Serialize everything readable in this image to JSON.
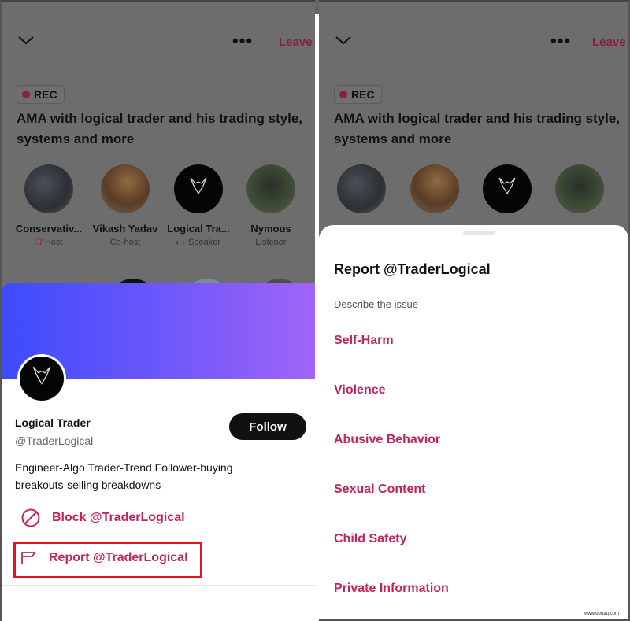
{
  "space": {
    "leave_label": "Leave",
    "more_label": "•••",
    "rec_label": "REC",
    "title": "AMA with logical trader and his trading style, systems and more",
    "speakers": [
      {
        "name": "Conservativ...",
        "role": "Host",
        "status_icon": "mic-off-icon"
      },
      {
        "name": "Vikash Yadav",
        "role": "Co-host",
        "status_icon": ""
      },
      {
        "name": "Logical Tra...",
        "role": "Speaker",
        "status_icon": "speaking-bars-icon"
      },
      {
        "name": "Nymous",
        "role": "Listener",
        "status_icon": ""
      }
    ]
  },
  "profile": {
    "name": "Logical Trader",
    "handle": "@TraderLogical",
    "follow_label": "Follow",
    "bio": "Engineer-Algo Trader-Trend Follower-buying breakouts-selling breakdowns",
    "block_label": "Block @TraderLogical",
    "report_label": "Report @TraderLogical",
    "banner_gradient": [
      "#3d4bfb",
      "#a265f6"
    ]
  },
  "report": {
    "title": "Report @TraderLogical",
    "subtitle": "Describe the issue",
    "options": [
      "Self-Harm",
      "Violence",
      "Abusive Behavior",
      "Sexual Content",
      "Child Safety",
      "Private Information"
    ]
  },
  "colors": {
    "accent": "#c2245a",
    "highlight_box": "#e0141c",
    "dim_overlay": "#6d6d6d"
  },
  "watermark": "www.deuaq.com"
}
